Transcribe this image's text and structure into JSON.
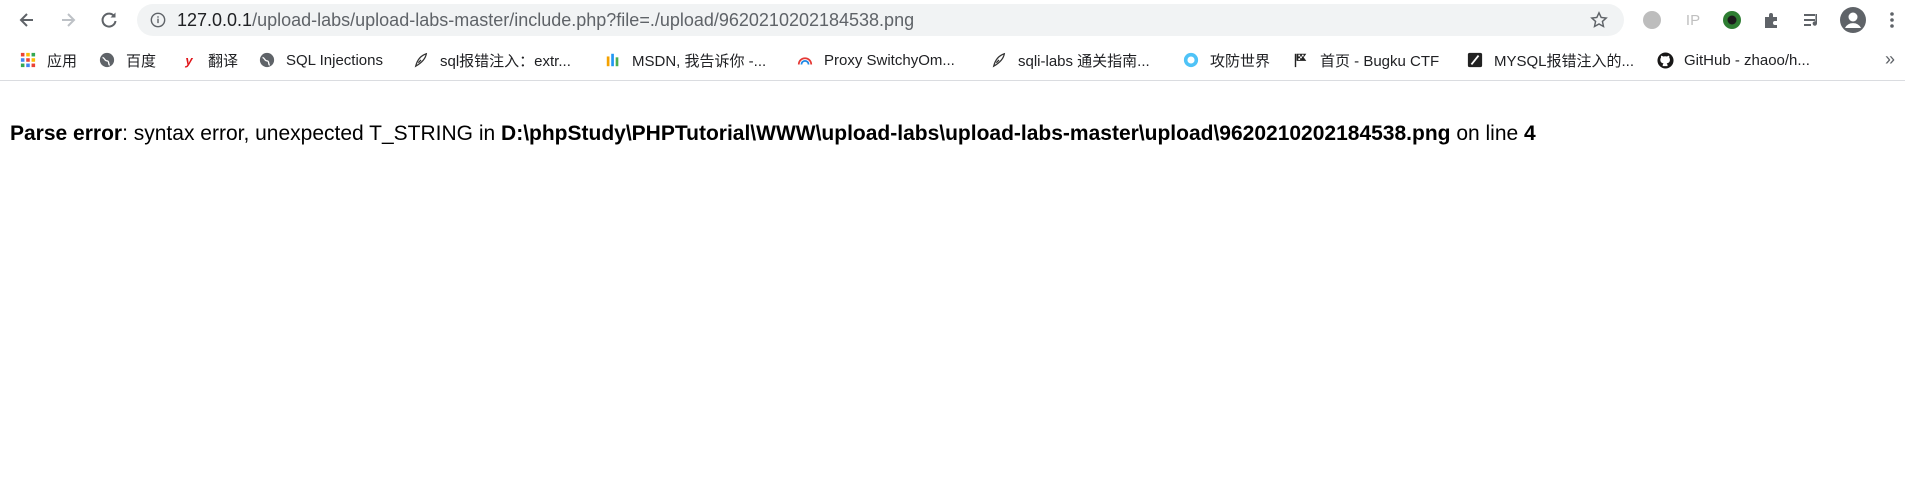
{
  "browser": {
    "url_host": "127.0.0.1",
    "url_path": "/upload-labs/upload-labs-master/include.php?file=./upload/9620210202184538.png",
    "ip_ext_label": "IP"
  },
  "bookmarks": [
    {
      "label": "应用",
      "icon": "apps-grid-icon"
    },
    {
      "label": "百度",
      "icon": "globe-icon"
    },
    {
      "label": "翻译",
      "icon": "youdao-icon"
    },
    {
      "label": "SQL Injections",
      "icon": "globe-icon"
    },
    {
      "label": "sql报错注入：extr...",
      "icon": "feather-icon"
    },
    {
      "label": "MSDN, 我告诉你 -...",
      "icon": "msdn-icon"
    },
    {
      "label": "Proxy SwitchyOm...",
      "icon": "rainbow-icon"
    },
    {
      "label": "sqli-labs 通关指南...",
      "icon": "feather-icon"
    },
    {
      "label": "攻防世界",
      "icon": "adworld-icon"
    },
    {
      "label": "首页 - Bugku CTF",
      "icon": "flag-icon"
    },
    {
      "label": "MYSQL报错注入的...",
      "icon": "zhihu-icon"
    },
    {
      "label": "GitHub - zhaoo/h...",
      "icon": "github-icon"
    }
  ],
  "bookmarks_more": "»",
  "error": {
    "label": "Parse error",
    "message": ": syntax error, unexpected T_STRING in ",
    "path": "D:\\phpStudy\\PHPTutorial\\WWW\\upload-labs\\upload-labs-master\\upload\\9620210202184538.png",
    "line_text": " on line ",
    "line_number": "4"
  }
}
